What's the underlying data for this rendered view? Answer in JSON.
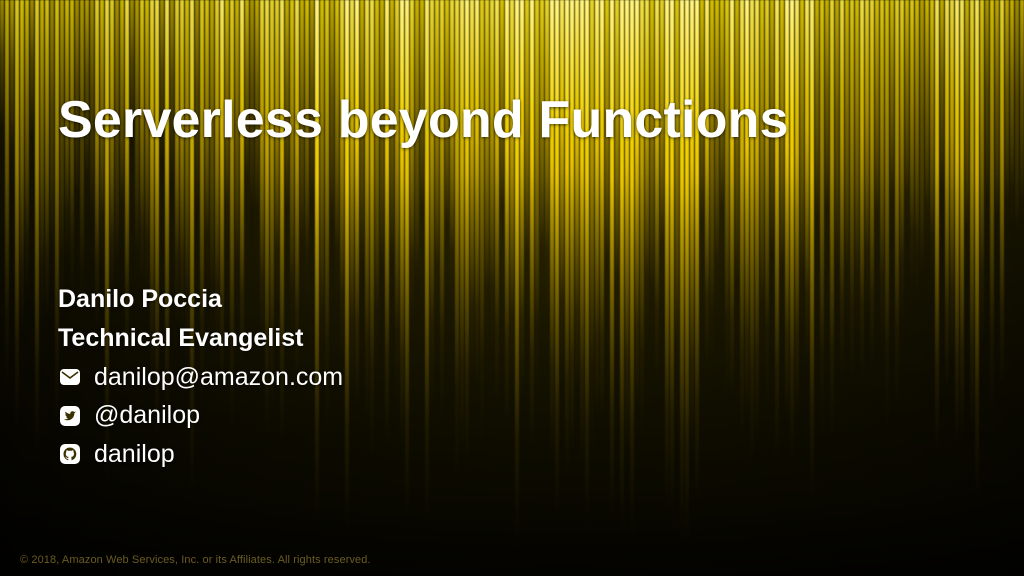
{
  "title": "Serverless beyond Functions",
  "author": {
    "name": "Danilo Poccia",
    "role": "Technical Evangelist",
    "email": "danilop@amazon.com",
    "twitter": "@danilop",
    "github": "danilop"
  },
  "copyright": "© 2018, Amazon Web Services, Inc. or its Affiliates. All rights reserved."
}
